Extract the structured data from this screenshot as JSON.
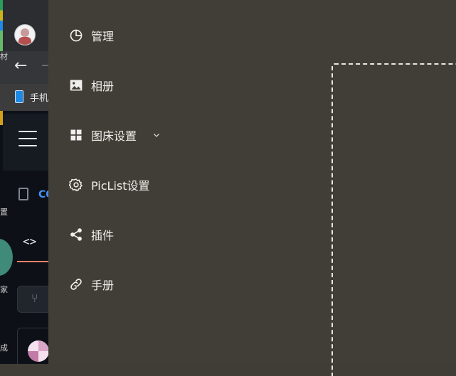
{
  "background_app": {
    "bookmark_label": "手机",
    "repo_label": "CO",
    "edge_chars": [
      "材",
      "置",
      "家",
      "成"
    ]
  },
  "drawer": {
    "menu": [
      {
        "id": "manage",
        "label": "管理",
        "icon": "pie-chart-icon"
      },
      {
        "id": "gallery",
        "label": "相册",
        "icon": "image-icon"
      },
      {
        "id": "picbed-settings",
        "label": "图床设置",
        "icon": "grid-icon",
        "expandable": true
      },
      {
        "id": "piclist-settings",
        "label": "PicList设置",
        "icon": "gear-icon"
      },
      {
        "id": "plugins",
        "label": "插件",
        "icon": "share-icon"
      },
      {
        "id": "manual",
        "label": "手册",
        "icon": "link-icon"
      }
    ]
  },
  "colors": {
    "drawer_bg": "#413e38",
    "text": "#f1efeb",
    "dashed_border": "#e9e7e2"
  }
}
